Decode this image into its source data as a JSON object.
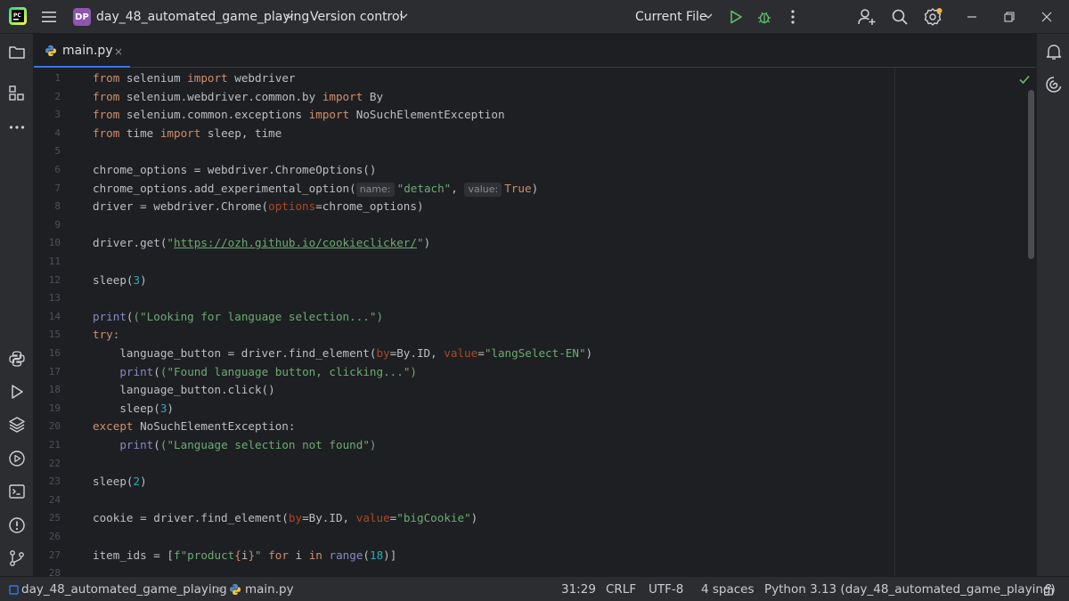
{
  "titlebar": {
    "project_badge": "DP",
    "project_name": "day_48_automated_game_playing",
    "vcs_label": "Version control",
    "run_config": "Current File"
  },
  "tabs": [
    {
      "label": "main.py",
      "close": "×"
    }
  ],
  "editor": {
    "line_numbers": [
      "1",
      "2",
      "3",
      "4",
      "5",
      "6",
      "7",
      "8",
      "9",
      "10",
      "11",
      "12",
      "13",
      "14",
      "15",
      "16",
      "17",
      "18",
      "19",
      "20",
      "21",
      "22",
      "23",
      "24",
      "25",
      "26",
      "27",
      "28"
    ],
    "hints": {
      "name": "name:",
      "value": "value:"
    },
    "tokens": {
      "from": "from",
      "import": "import",
      "try": "try:",
      "except": "except",
      "for": "for",
      "in": "in",
      "selenium": " selenium ",
      "webdriver": " webdriver",
      "l2_mod": " selenium.webdriver.common.by ",
      "By": " By",
      "l3_mod": " selenium.common.exceptions ",
      "NSEE": " NoSuchElementException",
      "time": " time ",
      "sleep_time": " sleep, time",
      "l6": "chrome_options = webdriver.ChromeOptions()",
      "l7a": "chrome_options.add_experimental_option(",
      "detach": "\"detach\"",
      "comma": ", ",
      "True": "True",
      "rparen": ")",
      "l8a": "driver = webdriver.Chrome(",
      "options": "options",
      "l8b": "=chrome_options)",
      "l10a": "driver.get(",
      "q": "\"",
      "url": "https://ozh.github.io/cookieclicker/",
      "l10b": "\")",
      "sleep_open": "sleep(",
      "three": "3",
      "two": "2",
      "close_paren": ")",
      "print": "print",
      "l14s": "(\"Looking for language selection...\")",
      "l16a": "    language_button = driver.find_element(",
      "by": "by",
      "l16b": "=By.ID, ",
      "value": "value",
      "l16c": "=",
      "l16s": "\"langSelect-EN\"",
      "indent": "    ",
      "l17s": "(\"Found language button, clicking...\")",
      "l18": "    language_button.click()",
      "l19a": "    sleep(",
      "l20b": " NoSuchElementException:",
      "l21s": "(\"Language selection not found\")",
      "l25a": "cookie = driver.find_element(",
      "l25s": "\"bigCookie\"",
      "l27a": "item_ids = [",
      "fpre": "f\"product",
      "lbrace": "{",
      "i": "i",
      "rbrace": "}",
      "fpost": "\"",
      "sp": " ",
      "i_sp": " i ",
      "range": "range",
      "eighteen": "18",
      "l27end": ")]",
      "lparen": "("
    }
  },
  "statusbar": {
    "project": "day_48_automated_game_playing",
    "sep": ">",
    "file": "main.py",
    "position": "31:29",
    "line_ending": "CRLF",
    "encoding": "UTF-8",
    "indent": "4 spaces",
    "interpreter": "Python 3.13 (day_48_automated_game_playing)"
  }
}
